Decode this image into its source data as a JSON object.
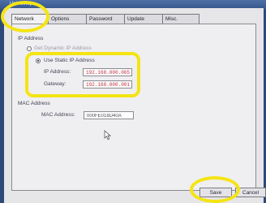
{
  "window": {
    "title": "Unit Setup"
  },
  "tabs": [
    {
      "label": "Network",
      "active": true
    },
    {
      "label": "Options"
    },
    {
      "label": "Password"
    },
    {
      "label": "Update"
    },
    {
      "label": "Misc."
    }
  ],
  "ip_section": {
    "title": "IP Address",
    "option_dynamic": "Get Dynamic IP Address",
    "option_static": "Use Static IP Address",
    "selected": "static",
    "ip_label": "IP Address:",
    "ip_value": "192.168.000.065",
    "gateway_label": "Gateway:",
    "gateway_value": "192.168.000.001"
  },
  "mac_section": {
    "title": "MAC Address",
    "mac_label": "MAC Address:",
    "mac_value": "000FE018D40A"
  },
  "buttons": {
    "save": "Save",
    "cancel": "Cancel"
  },
  "colors": {
    "highlight": "#f4e414",
    "title_bar": "#35558a",
    "field_text": "#c03040"
  }
}
